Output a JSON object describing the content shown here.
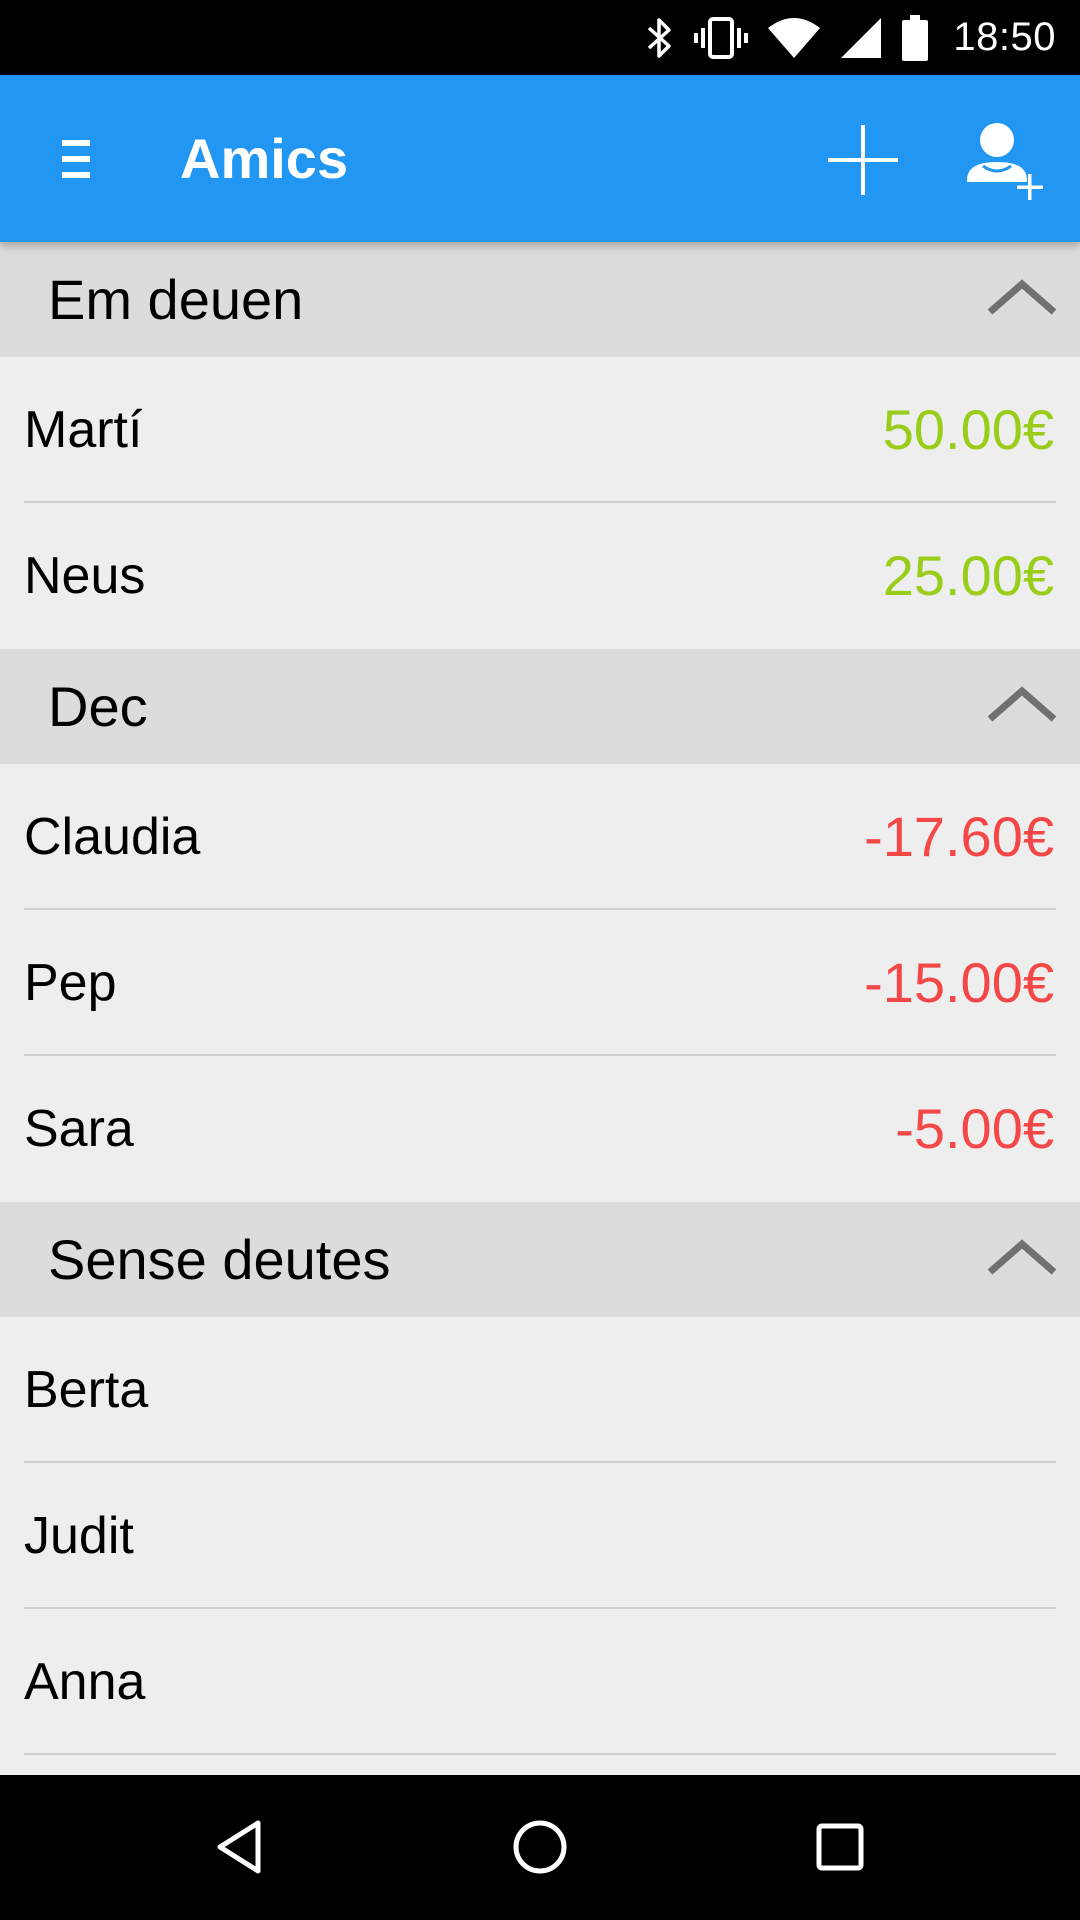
{
  "status_bar": {
    "time": "18:50",
    "icons": [
      "bluetooth-icon",
      "vibrate-icon",
      "wifi-icon",
      "signal-icon",
      "battery-icon"
    ]
  },
  "app_bar": {
    "title": "Amics",
    "menu_icon": "menu-icon",
    "actions": [
      "add-icon",
      "add-friend-icon"
    ]
  },
  "sections": [
    {
      "title": "Em deuen",
      "amount_color": "#9acd1a",
      "rows": [
        {
          "name": "Martí",
          "amount": "50.00€"
        },
        {
          "name": "Neus",
          "amount": "25.00€"
        }
      ]
    },
    {
      "title": "Dec",
      "amount_color": "#f44848",
      "rows": [
        {
          "name": "Claudia",
          "amount": "-17.60€"
        },
        {
          "name": "Pep",
          "amount": "-15.00€"
        },
        {
          "name": "Sara",
          "amount": "-5.00€"
        }
      ]
    },
    {
      "title": "Sense deutes",
      "rows": [
        {
          "name": "Berta",
          "amount": ""
        },
        {
          "name": "Judit",
          "amount": ""
        },
        {
          "name": "Anna",
          "amount": ""
        }
      ]
    }
  ],
  "nav_bar": {
    "buttons": [
      "back-icon",
      "home-icon",
      "recents-icon"
    ]
  },
  "colors": {
    "app_bar": "#2196f3",
    "section_header": "#dcdcdc",
    "background": "#eeeeee",
    "positive": "#9acd1a",
    "negative": "#f44848"
  }
}
